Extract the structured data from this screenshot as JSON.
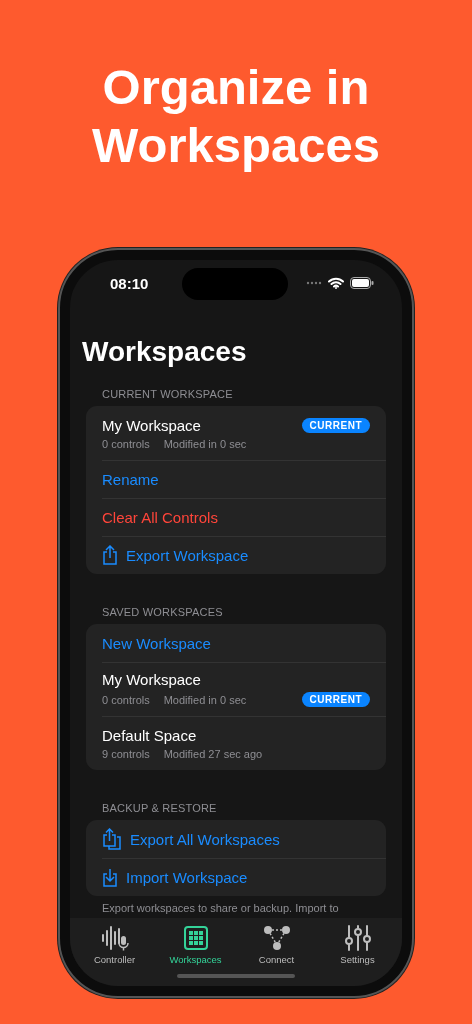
{
  "headline": "Organize in Workspaces",
  "status_bar": {
    "time": "08:10"
  },
  "title": "Workspaces",
  "sections": [
    {
      "header": "CURRENT WORKSPACE",
      "rows": [
        {
          "kind": "active",
          "name": "My Workspace",
          "controls": "0 controls",
          "modified": "Modified in 0 sec",
          "badge": "CURRENT"
        },
        {
          "kind": "action",
          "label": "Rename"
        },
        {
          "kind": "danger",
          "label": "Clear All Controls"
        },
        {
          "kind": "export",
          "label": "Export Workspace"
        }
      ]
    },
    {
      "header": "SAVED WORKSPACES",
      "rows": [
        {
          "kind": "action",
          "label": "New Workspace"
        },
        {
          "kind": "workspace",
          "name": "My Workspace",
          "controls": "0 controls",
          "modified": "Modified in 0 sec",
          "badge": "CURRENT"
        },
        {
          "kind": "workspace",
          "name": "Default Space",
          "controls": "9 controls",
          "modified": "Modified 27 sec ago"
        }
      ]
    },
    {
      "header": "BACKUP & RESTORE",
      "rows": [
        {
          "kind": "bulk",
          "label": "Export All Workspaces"
        },
        {
          "kind": "import",
          "label": "Import Workspace"
        }
      ],
      "footer": "Export workspaces to share or backup. Import to"
    }
  ],
  "tab_bar": [
    {
      "label": "Controller",
      "selected": false
    },
    {
      "label": "Workspaces",
      "selected": true
    },
    {
      "label": "Connect",
      "selected": false
    },
    {
      "label": "Settings",
      "selected": false
    }
  ]
}
